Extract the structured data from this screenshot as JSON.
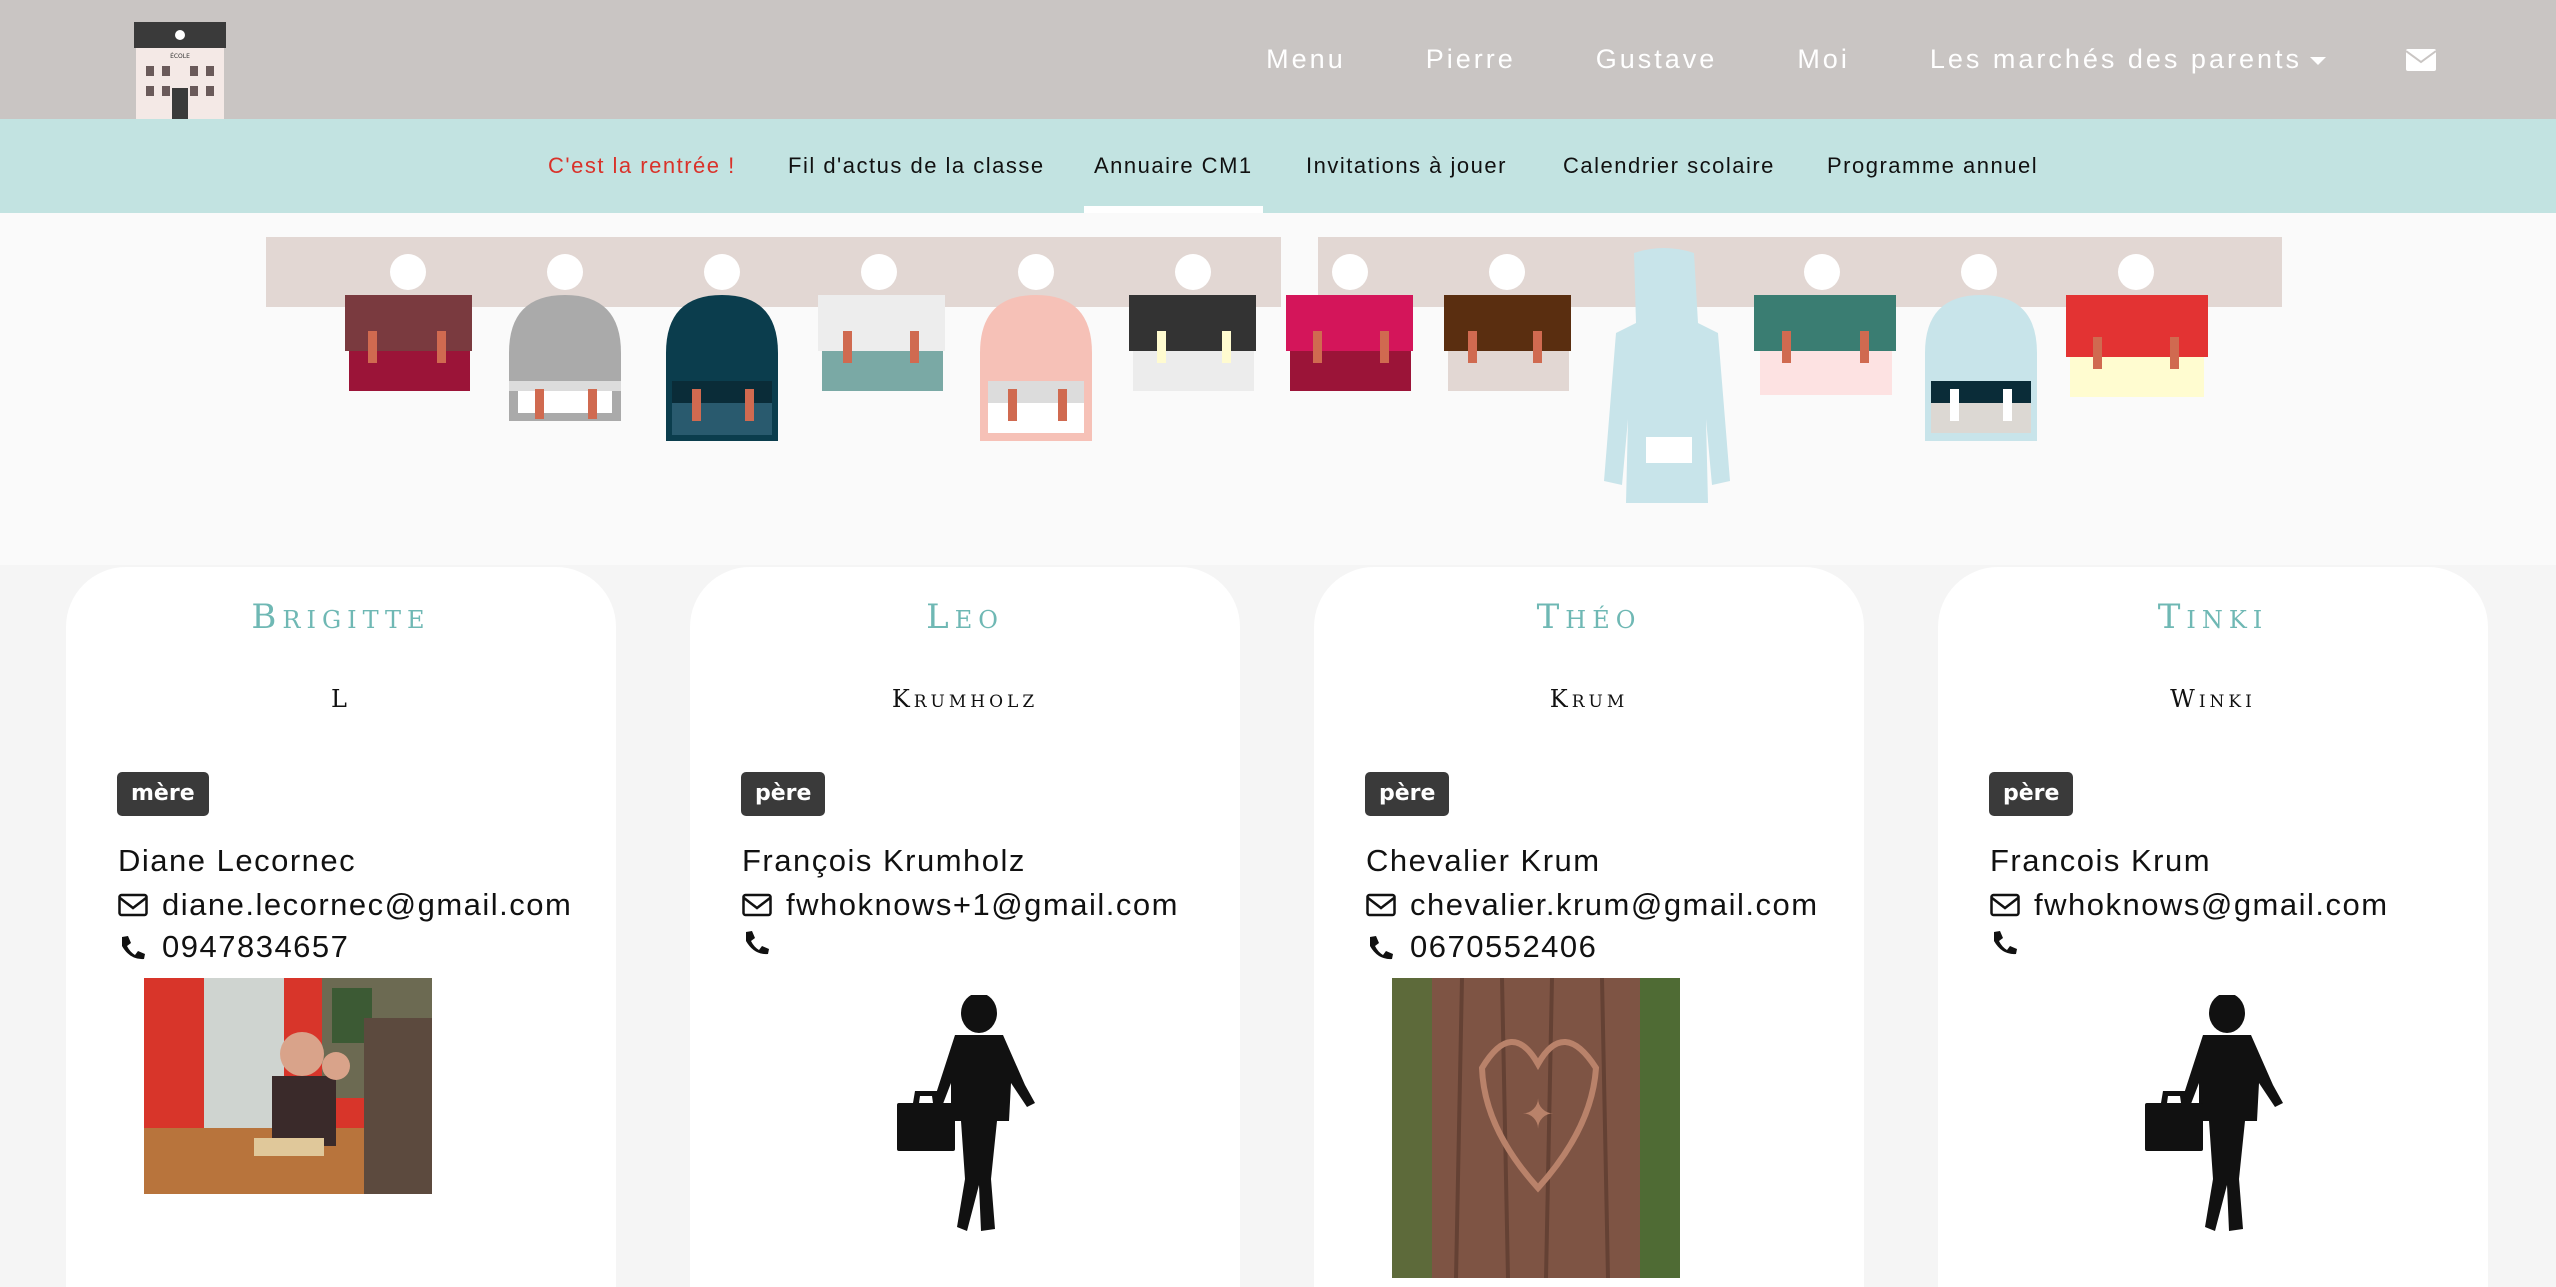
{
  "topnav": {
    "menu": "Menu",
    "pierre": "Pierre",
    "gustave": "Gustave",
    "moi": "Moi",
    "marches": "Les marchés des parents"
  },
  "logo": {
    "sign": "ÉCOLE"
  },
  "subnav": {
    "rentree": "C'est la rentrée !",
    "fil": "Fil d'actus de la classe",
    "annuaire": "Annuaire CM1",
    "invitations": "Invitations à jouer",
    "calendrier": "Calendrier scolaire",
    "programme": "Programme annuel"
  },
  "colors": {
    "topnav_bg": "#c9c5c3",
    "subnav_bg": "#c2e3e1",
    "highlight": "#d9322a",
    "first_name": "#6fb8b4",
    "badge_bg": "#3a3a3a"
  },
  "cards": [
    {
      "first": "Brigitte",
      "last": "L",
      "role": "mère",
      "parent": "Diane Lecornec",
      "email": "diane.lecornec@gmail.com",
      "phone": "0947834657",
      "photo": "family-photo"
    },
    {
      "first": "Leo",
      "last": "Krumholz",
      "role": "père",
      "parent": "François Krumholz",
      "email": "fwhoknows+1@gmail.com",
      "phone": "",
      "photo": "silhouette-placeholder"
    },
    {
      "first": "Théo",
      "last": "Krum",
      "role": "père",
      "parent": "Chevalier Krum",
      "email": "chevalier.krum@gmail.com",
      "phone": "0670552406",
      "photo": "tree-bark-photo"
    },
    {
      "first": "Tinki",
      "last": "Winki",
      "role": "père",
      "parent": "Francois Krum",
      "email": "fwhoknows@gmail.com",
      "phone": "",
      "photo": "silhouette-placeholder"
    }
  ]
}
